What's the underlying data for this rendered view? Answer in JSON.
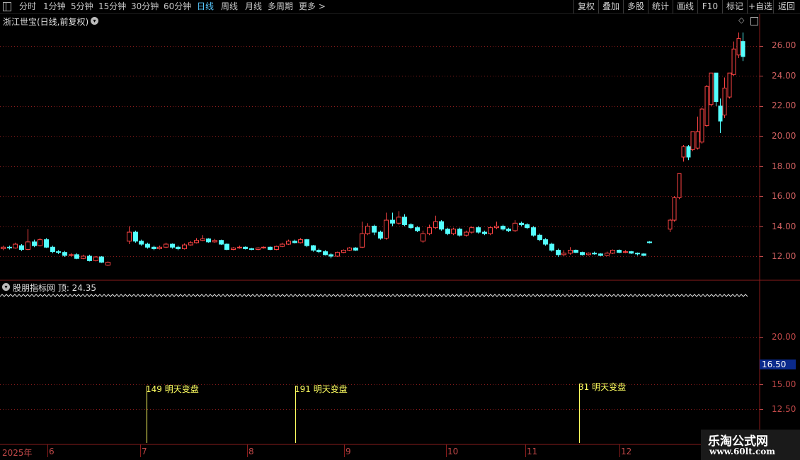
{
  "toolbar": {
    "periods": [
      {
        "label": "分时"
      },
      {
        "label": "1分钟"
      },
      {
        "label": "5分钟"
      },
      {
        "label": "15分钟"
      },
      {
        "label": "30分钟"
      },
      {
        "label": "60分钟"
      },
      {
        "label": "日线",
        "active": true
      },
      {
        "label": "周线"
      },
      {
        "label": "月线"
      },
      {
        "label": "多周期"
      },
      {
        "label": "更多 >"
      }
    ],
    "right_buttons": [
      {
        "label": "复权"
      },
      {
        "label": "叠加"
      },
      {
        "label": "多股"
      },
      {
        "label": "统计"
      },
      {
        "label": "画线"
      },
      {
        "label": "F10"
      },
      {
        "label": "标记"
      },
      {
        "label": "+自选"
      },
      {
        "label": "返回"
      }
    ]
  },
  "main_chart": {
    "title": "浙江世宝(日线,前复权)",
    "y_ticks": [
      "26.00",
      "24.00",
      "22.00",
      "20.00",
      "18.00",
      "16.00",
      "14.00",
      "12.00"
    ]
  },
  "indicator": {
    "title": "股朋指标网  顶: 24.35",
    "y_ticks": [
      "20.00",
      "15.00",
      "12.50"
    ],
    "price_tag": "16.50",
    "signals": [
      {
        "text": "149 明天变盘"
      },
      {
        "text": "191 明天变盘"
      },
      {
        "text": "31 明天变盘"
      }
    ]
  },
  "x_axis": {
    "labels": [
      "2025年",
      "6",
      "7",
      "8",
      "9",
      "10",
      "11",
      "12"
    ]
  },
  "watermark": {
    "title": "乐淘公式网",
    "url": "www.60lt.com"
  },
  "colors": {
    "up": "#ff4444",
    "down": "#54ffff",
    "grid": "#8a1c1c",
    "signal": "#ffff60"
  },
  "chart_data": {
    "type": "candlestick",
    "title": "浙江世宝(日线,前复权)",
    "ylim": [
      11,
      27.5
    ],
    "candles": [
      [
        12.5,
        12.6,
        12.4,
        12.7
      ],
      [
        12.6,
        12.55,
        12.45,
        12.7
      ],
      [
        12.55,
        12.8,
        12.5,
        12.9
      ],
      [
        12.7,
        12.45,
        12.35,
        12.8
      ],
      [
        12.45,
        12.95,
        12.4,
        13.8
      ],
      [
        12.95,
        12.7,
        12.6,
        13.1
      ],
      [
        12.7,
        13.1,
        12.65,
        13.2
      ],
      [
        13.1,
        12.6,
        12.55,
        13.2
      ],
      [
        12.6,
        12.3,
        12.2,
        12.7
      ],
      [
        12.3,
        12.25,
        12.15,
        12.4
      ],
      [
        12.25,
        12.05,
        11.95,
        12.35
      ],
      [
        12.05,
        12.1,
        11.95,
        12.2
      ],
      [
        12.1,
        11.85,
        11.8,
        12.2
      ],
      [
        11.85,
        12.0,
        11.8,
        12.1
      ],
      [
        12.0,
        11.7,
        11.65,
        12.1
      ],
      [
        11.7,
        11.95,
        11.65,
        12.0
      ],
      [
        11.95,
        11.6,
        11.55,
        12.0
      ],
      [
        11.4,
        11.6,
        11.35,
        11.65
      ],
      [
        13.0,
        13.6,
        12.8,
        14.0
      ],
      [
        13.6,
        13.0,
        12.9,
        13.7
      ],
      [
        13.0,
        12.8,
        12.7,
        13.1
      ],
      [
        12.8,
        12.6,
        12.5,
        12.9
      ],
      [
        12.6,
        12.5,
        12.4,
        12.7
      ],
      [
        12.5,
        12.6,
        12.45,
        12.7
      ],
      [
        12.6,
        12.8,
        12.55,
        12.9
      ],
      [
        12.8,
        12.6,
        12.5,
        12.85
      ],
      [
        12.6,
        12.5,
        12.4,
        12.7
      ],
      [
        12.5,
        12.75,
        12.45,
        12.85
      ],
      [
        12.75,
        12.9,
        12.7,
        13.0
      ],
      [
        12.9,
        13.05,
        12.85,
        13.2
      ],
      [
        13.05,
        13.15,
        13.0,
        13.4
      ],
      [
        13.15,
        12.95,
        12.9,
        13.2
      ],
      [
        12.95,
        13.05,
        12.9,
        13.15
      ],
      [
        13.05,
        12.8,
        12.75,
        13.1
      ],
      [
        12.8,
        12.45,
        12.4,
        12.85
      ],
      [
        12.45,
        12.55,
        12.4,
        12.6
      ],
      [
        12.55,
        12.6,
        12.5,
        12.7
      ],
      [
        12.6,
        12.5,
        12.45,
        12.65
      ],
      [
        12.5,
        12.45,
        12.4,
        12.55
      ],
      [
        12.45,
        12.55,
        12.4,
        12.6
      ],
      [
        12.55,
        12.6,
        12.5,
        12.65
      ],
      [
        12.6,
        12.45,
        12.4,
        12.65
      ],
      [
        12.45,
        12.65,
        12.4,
        12.7
      ],
      [
        12.65,
        12.8,
        12.6,
        12.9
      ],
      [
        12.8,
        13.0,
        12.75,
        13.1
      ],
      [
        13.0,
        12.9,
        12.85,
        13.1
      ],
      [
        12.9,
        13.1,
        12.85,
        13.2
      ],
      [
        13.1,
        12.7,
        12.6,
        13.15
      ],
      [
        12.7,
        12.4,
        12.3,
        12.75
      ],
      [
        12.4,
        12.3,
        12.2,
        12.5
      ],
      [
        12.3,
        12.1,
        12.05,
        12.4
      ],
      [
        12.1,
        12.0,
        11.85,
        12.2
      ],
      [
        12.0,
        12.25,
        11.95,
        12.3
      ],
      [
        12.25,
        12.4,
        12.2,
        12.45
      ],
      [
        12.4,
        12.55,
        12.35,
        12.6
      ],
      [
        12.55,
        12.4,
        12.35,
        12.6
      ],
      [
        12.6,
        13.5,
        12.55,
        14.3
      ],
      [
        13.5,
        14.0,
        13.4,
        14.2
      ],
      [
        14.0,
        13.6,
        13.4,
        14.1
      ],
      [
        13.6,
        13.2,
        13.1,
        13.7
      ],
      [
        13.2,
        14.4,
        13.1,
        14.9
      ],
      [
        14.4,
        14.2,
        14.0,
        14.9
      ],
      [
        14.2,
        14.6,
        14.1,
        15.0
      ],
      [
        14.6,
        14.1,
        14.0,
        14.8
      ],
      [
        14.1,
        13.9,
        13.8,
        14.2
      ],
      [
        13.9,
        13.7,
        13.6,
        14.0
      ],
      [
        13.0,
        13.5,
        12.9,
        13.7
      ],
      [
        13.5,
        13.9,
        13.4,
        14.1
      ],
      [
        13.9,
        14.3,
        13.8,
        14.7
      ],
      [
        14.3,
        13.8,
        13.7,
        14.4
      ],
      [
        13.8,
        13.5,
        13.4,
        13.9
      ],
      [
        13.5,
        13.8,
        13.4,
        13.9
      ],
      [
        13.8,
        13.4,
        13.3,
        13.9
      ],
      [
        13.4,
        13.6,
        13.3,
        13.7
      ],
      [
        13.6,
        13.9,
        13.5,
        14.0
      ],
      [
        13.9,
        13.6,
        13.5,
        14.0
      ],
      [
        13.6,
        13.5,
        13.4,
        13.7
      ],
      [
        13.5,
        13.9,
        13.4,
        14.0
      ],
      [
        13.9,
        14.0,
        13.8,
        14.3
      ],
      [
        14.0,
        13.8,
        13.7,
        14.1
      ],
      [
        13.8,
        13.7,
        13.6,
        13.9
      ],
      [
        13.7,
        14.2,
        13.6,
        14.4
      ],
      [
        14.2,
        14.1,
        14.0,
        14.3
      ],
      [
        14.1,
        13.9,
        13.8,
        14.2
      ],
      [
        13.9,
        13.4,
        13.3,
        14.0
      ],
      [
        13.4,
        13.1,
        13.0,
        13.5
      ],
      [
        13.1,
        12.8,
        12.7,
        13.2
      ],
      [
        12.8,
        12.4,
        12.3,
        12.9
      ],
      [
        12.4,
        12.1,
        11.95,
        12.5
      ],
      [
        12.1,
        12.2,
        12.0,
        12.4
      ],
      [
        12.2,
        12.4,
        12.1,
        12.6
      ],
      [
        12.4,
        12.25,
        12.2,
        12.45
      ],
      [
        12.25,
        12.1,
        12.05,
        12.3
      ],
      [
        12.1,
        12.2,
        12.05,
        12.25
      ],
      [
        12.2,
        12.15,
        12.1,
        12.3
      ],
      [
        12.15,
        12.05,
        12.0,
        12.2
      ],
      [
        12.05,
        12.2,
        12.0,
        12.3
      ],
      [
        12.2,
        12.4,
        12.15,
        12.45
      ],
      [
        12.4,
        12.25,
        12.2,
        12.45
      ],
      [
        12.25,
        12.3,
        12.2,
        12.4
      ],
      [
        12.3,
        12.2,
        12.15,
        12.35
      ],
      [
        12.2,
        12.15,
        12.05,
        12.25
      ],
      [
        12.15,
        12.05,
        12.0,
        12.2
      ],
      [
        12.95,
        12.9,
        12.85,
        13.0
      ],
      [
        13.8,
        14.4,
        13.6,
        14.5
      ],
      [
        14.4,
        15.9,
        14.3,
        16.0
      ],
      [
        15.9,
        17.5,
        15.8,
        17.5
      ],
      [
        18.6,
        19.3,
        18.3,
        19.4
      ],
      [
        19.3,
        18.6,
        18.4,
        19.4
      ],
      [
        19.1,
        20.3,
        19.0,
        20.3
      ],
      [
        19.2,
        20.3,
        19.1,
        21.3
      ],
      [
        19.6,
        21.8,
        19.5,
        21.9
      ],
      [
        20.7,
        23.3,
        20.6,
        23.4
      ],
      [
        22.1,
        24.2,
        22.0,
        24.2
      ],
      [
        24.2,
        22.3,
        22.0,
        24.2
      ],
      [
        22.0,
        21.0,
        20.2,
        22.5
      ],
      [
        21.4,
        23.2,
        21.2,
        23.9
      ],
      [
        22.6,
        24.2,
        22.5,
        24.2
      ],
      [
        24.1,
        25.8,
        24.0,
        26.3
      ],
      [
        25.4,
        26.5,
        25.2,
        26.9
      ],
      [
        26.3,
        25.3,
        25.0,
        26.9
      ]
    ],
    "candle_positions": [
      [
        0
      ],
      [
        1
      ],
      [
        2
      ],
      [
        3
      ],
      [
        4
      ],
      [
        5
      ],
      [
        6
      ],
      [
        7
      ],
      [
        8
      ],
      [
        9
      ],
      [
        10
      ],
      [
        11
      ],
      [
        12
      ],
      [
        13
      ],
      [
        14
      ],
      [
        15
      ],
      [
        16
      ],
      [
        17
      ],
      [
        18
      ],
      [
        19
      ],
      [
        20
      ],
      [
        21
      ],
      [
        22
      ],
      [
        23
      ],
      [
        24
      ],
      [
        25
      ],
      [
        26
      ],
      [
        27
      ],
      [
        28
      ],
      [
        29
      ],
      [
        30
      ],
      [
        31
      ],
      [
        32
      ],
      [
        33
      ],
      [
        34
      ],
      [
        35
      ],
      [
        36
      ],
      [
        37
      ],
      [
        38
      ],
      [
        39
      ],
      [
        40
      ],
      [
        41
      ],
      [
        42
      ],
      [
        43
      ],
      [
        44
      ],
      [
        45
      ],
      [
        46
      ],
      [
        47
      ],
      [
        48
      ],
      [
        49
      ],
      [
        50
      ],
      [
        51
      ],
      [
        52
      ],
      [
        53
      ],
      [
        54
      ],
      [
        55
      ],
      [
        56
      ],
      [
        57
      ],
      [
        58
      ],
      [
        59
      ],
      [
        60
      ],
      [
        61
      ],
      [
        62
      ],
      [
        63
      ],
      [
        64
      ],
      [
        65
      ],
      [
        66
      ],
      [
        67
      ],
      [
        68
      ],
      [
        69
      ],
      [
        70
      ],
      [
        71
      ],
      [
        72
      ],
      [
        73
      ],
      [
        74
      ],
      [
        75
      ],
      [
        76
      ],
      [
        77
      ],
      [
        78
      ],
      [
        79
      ],
      [
        80
      ],
      [
        81
      ],
      [
        82
      ],
      [
        83
      ],
      [
        84
      ],
      [
        85
      ],
      [
        86
      ],
      [
        87
      ],
      [
        88
      ],
      [
        89
      ],
      [
        90
      ],
      [
        91
      ],
      [
        92
      ],
      [
        93
      ],
      [
        94
      ],
      [
        95
      ],
      [
        96
      ],
      [
        97
      ],
      [
        98
      ],
      [
        99
      ],
      [
        100
      ],
      [
        101
      ],
      [
        102
      ],
      [
        103
      ],
      [
        104
      ],
      [
        105
      ],
      [
        106
      ],
      [
        107
      ],
      [
        108
      ],
      [
        109
      ],
      [
        110
      ],
      [
        111
      ],
      [
        112
      ],
      [
        113
      ],
      [
        114
      ],
      [
        115
      ],
      [
        116
      ],
      [
        117
      ],
      [
        118
      ]
    ]
  }
}
